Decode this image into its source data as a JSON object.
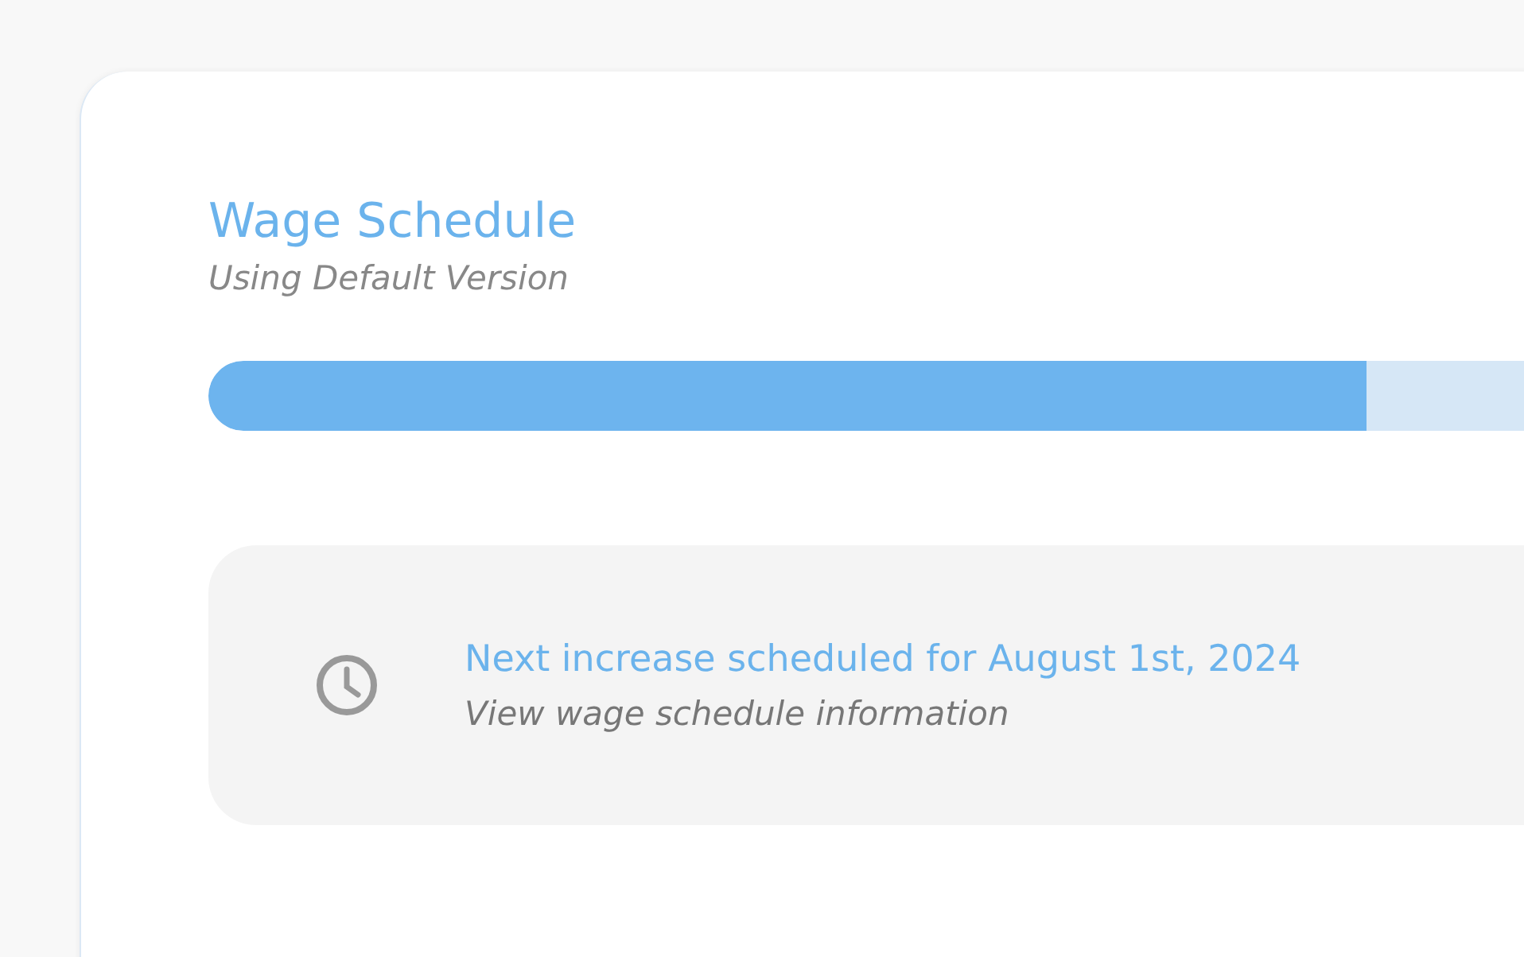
{
  "header": {
    "title": "Wage Schedule",
    "subtitle": "Using Default Version"
  },
  "progress": {
    "level": 0.88
  },
  "notice": {
    "title": "Next increase scheduled for August 1st, 2024",
    "link": "View wage schedule information"
  }
}
